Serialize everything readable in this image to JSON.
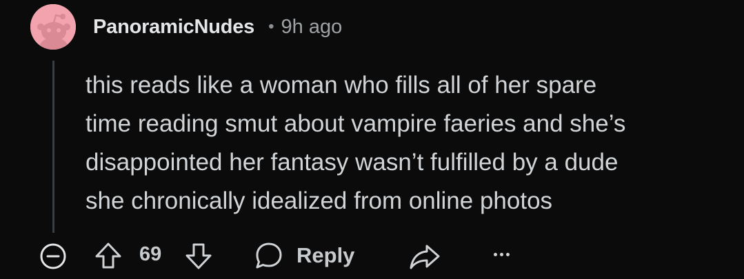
{
  "comment": {
    "avatar_icon": "reddit-snoo-avatar-icon",
    "username": "PanoramicNudes",
    "separator": "•",
    "time_ago": "9h ago",
    "body_lines": [
      "this reads like a woman who fills all of her spare",
      "time reading smut about vampire faeries and she’s",
      "disappointed her fantasy wasn’t fulfilled by a dude",
      "she chronically idealized from online photos"
    ]
  },
  "actions": {
    "collapse_icon": "collapse-minus-icon",
    "upvote_icon": "upvote-arrow-icon",
    "score": "69",
    "downvote_icon": "downvote-arrow-icon",
    "reply_icon": "chat-bubble-icon",
    "reply_label": "Reply",
    "share_icon": "share-arrow-icon",
    "more_icon": "more-options-icon"
  },
  "colors": {
    "background": "#0b0b0c",
    "avatar_bg": "#f2a3ad",
    "text": "#d2d5d7",
    "muted": "#9ea3a6"
  }
}
